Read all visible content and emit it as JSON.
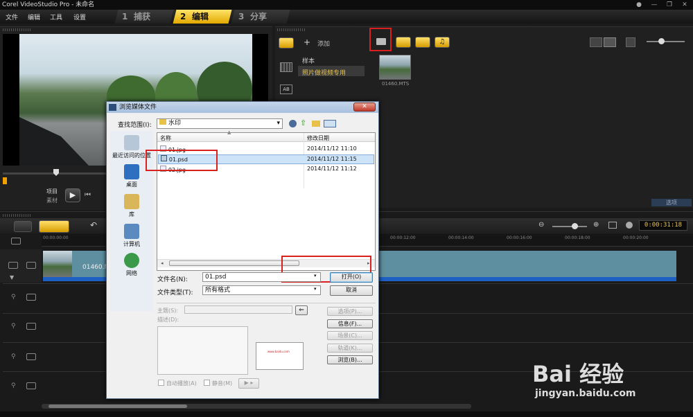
{
  "app": {
    "title": "Corel VideoStudio Pro - 未命名",
    "menu": [
      "文件",
      "编辑",
      "工具",
      "设置"
    ],
    "steps": [
      {
        "num": "1",
        "label": "捕获"
      },
      {
        "num": "2",
        "label": "编辑"
      },
      {
        "num": "3",
        "label": "分享"
      }
    ]
  },
  "player": {
    "project_label": "项目",
    "clip_label": "素材"
  },
  "library": {
    "add_label": "添加",
    "folders": [
      "样本",
      "照片做视频专用"
    ],
    "thumb_caption": "01460.MTS",
    "options_label": "选项"
  },
  "timeline": {
    "timecode": "0:00:31:18",
    "clip_label": "01460.M",
    "ruler": [
      "00:00:00:00",
      "00:00:12:00",
      "00:00:14:00",
      "00:00:16:00",
      "00:00:18:00",
      "00:00:20:00"
    ]
  },
  "dialog": {
    "title": "浏览媒体文件",
    "lookin_label": "查找范围(I):",
    "lookin_value": "水印",
    "places": [
      "最近访问的位置",
      "桌面",
      "库",
      "计算机",
      "网络"
    ],
    "col_name": "名称",
    "col_date": "修改日期",
    "files": [
      {
        "name": "01.jpg",
        "date": "2014/11/12 11:10"
      },
      {
        "name": "01.psd",
        "date": "2014/11/12 11:15"
      },
      {
        "name": "02.jpg",
        "date": "2014/11/12 11:12"
      }
    ],
    "filename_label": "文件名(N):",
    "filename_value": "01.psd",
    "filetype_label": "文件类型(T):",
    "filetype_value": "所有格式",
    "open_label": "打开(O)",
    "cancel_label": "取消",
    "subject_label": "主题(S):",
    "desc_label": "描述(D):",
    "options_label": "选项(P)...",
    "info_label": "信息(F)...",
    "scene_label": "场景(C)...",
    "track_label": "轨道(K)...",
    "browse_label": "浏览(B)...",
    "autoplay_label": "自动播放(A)",
    "mute_label": "静音(M)",
    "preview_thumb_text": "www.baidu.com"
  },
  "watermark": {
    "text": "Bai 经验",
    "url": "jingyan.baidu.com"
  }
}
